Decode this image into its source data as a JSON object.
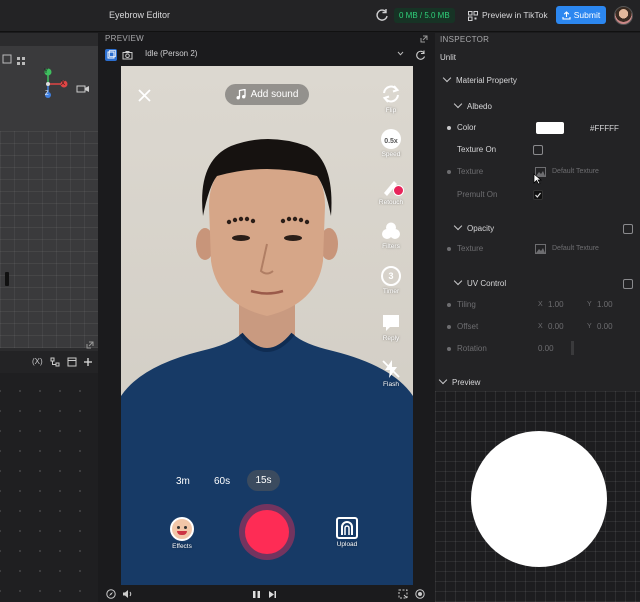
{
  "app": {
    "title": "Eyebrow Editor"
  },
  "topbar": {
    "storage": "0 MB / 5.0 MB",
    "preview_in_tiktok": "Preview in TikTok",
    "submit": "Submit"
  },
  "left_panel": {
    "axis_labels": {
      "y": "Y",
      "x": "X",
      "z": "Z"
    },
    "toolbar_label": "(X)"
  },
  "preview": {
    "header": "PREVIEW",
    "mode": "Idle (Person 2)",
    "phone": {
      "add_sound": "Add sound",
      "side_buttons": [
        "Flip",
        "Speed",
        "Retouch",
        "Filters",
        "Timer",
        "Reply",
        "Flash"
      ],
      "speed_badge": "0.5x",
      "timer_badge": "3",
      "durations": [
        "3m",
        "60s",
        "15s"
      ],
      "selected_duration": "15s",
      "effects": "Effects",
      "upload": "Upload"
    }
  },
  "inspector": {
    "header": "INSPECTOR",
    "material_name": "Unlit",
    "sections": {
      "material_property": "Material Property",
      "albedo": "Albedo",
      "opacity": "Opacity",
      "uv_control": "UV Control",
      "preview": "Preview"
    },
    "albedo": {
      "color_label": "Color",
      "color_value": "#FFFFF",
      "color_swatch": "#ffffff",
      "texture_on_label": "Texture On",
      "texture_label": "Texture",
      "texture_value": "Default Texture",
      "premult_label": "Premult On"
    },
    "opacity": {
      "texture_label": "Texture",
      "texture_value": "Default Texture"
    },
    "uv": {
      "tiling_label": "Tiling",
      "tiling_x": "1.00",
      "tiling_y": "1.00",
      "offset_label": "Offset",
      "offset_x": "0.00",
      "offset_y": "0.00",
      "rotation_label": "Rotation",
      "rotation_value": "0.00",
      "x": "X",
      "y": "Y"
    }
  },
  "colors": {
    "accent": "#2c87f0",
    "record": "#fe2c55",
    "storage_green": "#2fd07a"
  }
}
